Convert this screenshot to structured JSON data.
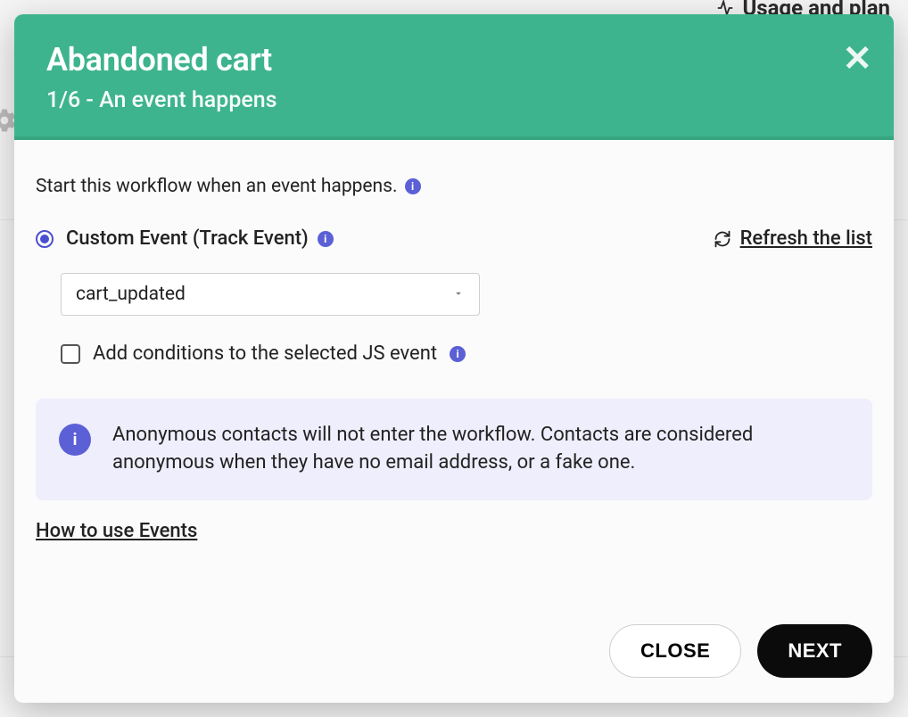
{
  "background": {
    "top_nav_label": "Usage and plan"
  },
  "modal": {
    "title": "Abandoned cart",
    "step_indicator": "1/6 - An event happens",
    "intro_text": "Start this workflow when an event happens.",
    "event_type_label": "Custom Event (Track Event)",
    "refresh_label": "Refresh the list",
    "selected_event": "cart_updated",
    "conditions_checkbox_label": "Add conditions to the selected JS event",
    "conditions_checked": false,
    "notice_text": "Anonymous contacts will not enter the workflow. Contacts are considered anonymous when they have no email address, or a fake one.",
    "howto_link": "How to use Events",
    "close_button": "CLOSE",
    "next_button": "NEXT"
  }
}
